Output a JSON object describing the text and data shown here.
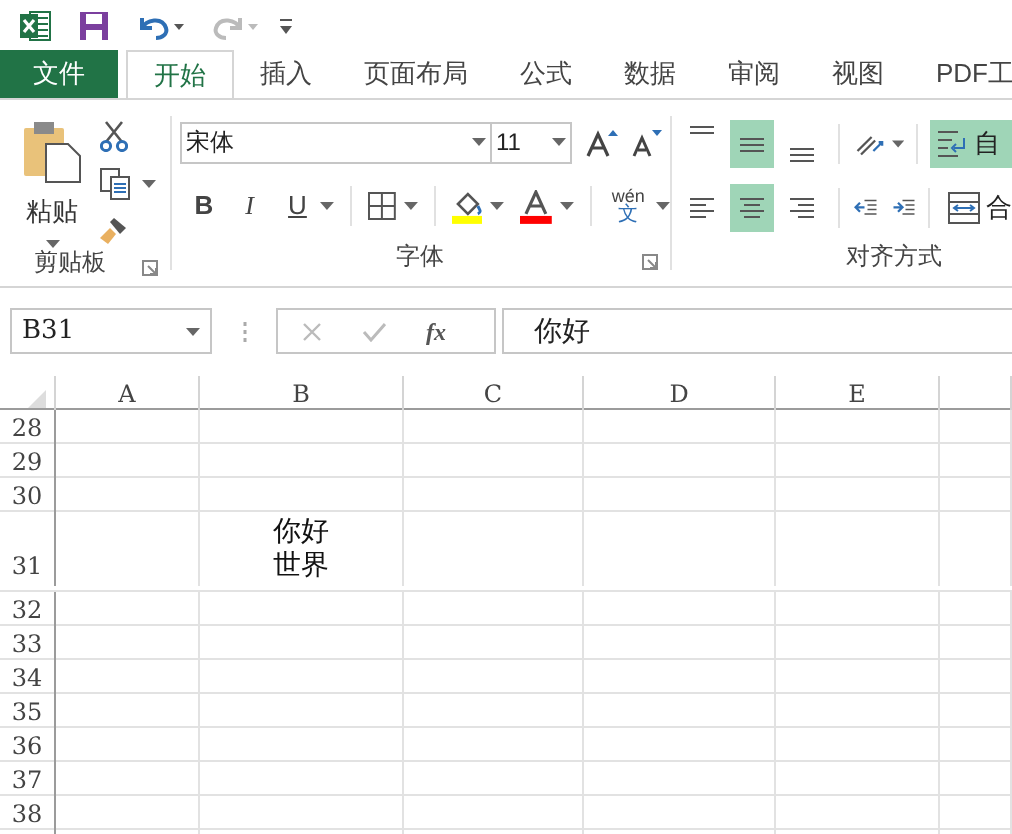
{
  "tabs": [
    {
      "label": "文件",
      "kind": "file",
      "selected": false
    },
    {
      "label": "开始",
      "kind": "tab",
      "selected": true
    },
    {
      "label": "插入",
      "kind": "tab",
      "selected": false
    },
    {
      "label": "页面布局",
      "kind": "tab",
      "selected": false
    },
    {
      "label": "公式",
      "kind": "tab",
      "selected": false
    },
    {
      "label": "数据",
      "kind": "tab",
      "selected": false
    },
    {
      "label": "审阅",
      "kind": "tab",
      "selected": false
    },
    {
      "label": "视图",
      "kind": "tab",
      "selected": false
    },
    {
      "label": "PDF工",
      "kind": "tab",
      "selected": false
    }
  ],
  "clipboard": {
    "paste_label": "粘贴",
    "group_label": "剪贴板"
  },
  "font": {
    "font_name": "宋体",
    "font_size": "11",
    "bold": "B",
    "italic": "I",
    "underline": "U",
    "phonetic": "wén",
    "phonetic_char": "文",
    "group_label": "字体"
  },
  "alignment": {
    "vertical": [
      {
        "kind": "top",
        "selected": false
      },
      {
        "kind": "middle",
        "selected": true
      },
      {
        "kind": "bottom",
        "selected": false
      }
    ],
    "horizontal": [
      {
        "kind": "left",
        "selected": false
      },
      {
        "kind": "center",
        "selected": true
      },
      {
        "kind": "right",
        "selected": false
      }
    ],
    "wrap_text": {
      "label": "自",
      "selected": true
    },
    "merge": {
      "label": "合"
    },
    "group_label": "对齐方式"
  },
  "formula_bar": {
    "name_box": "B31",
    "function_label": "fx",
    "formula": "你好"
  },
  "sheet": {
    "columns": [
      "A",
      "B",
      "C",
      "D",
      "E"
    ],
    "rows": [
      {
        "header": "28"
      },
      {
        "header": "29"
      },
      {
        "header": "30"
      },
      {
        "header": "31",
        "cells": [
          null,
          {
            "text": "你好世界"
          }
        ]
      },
      {
        "header": "32"
      },
      {
        "header": "33"
      },
      {
        "header": "34"
      },
      {
        "header": "35"
      },
      {
        "header": "36"
      },
      {
        "header": "37"
      },
      {
        "header": "38"
      }
    ]
  }
}
